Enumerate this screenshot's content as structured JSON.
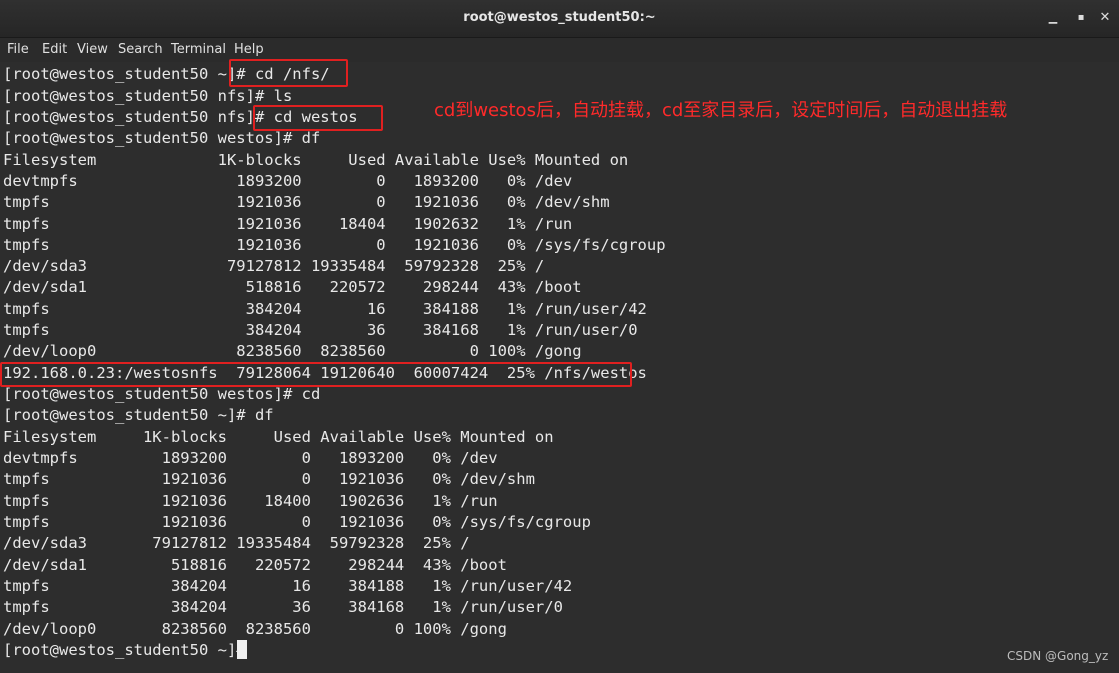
{
  "window": {
    "title": "root@westos_student50:~",
    "minimize_glyph": "▁",
    "maximize_glyph": "▪",
    "close_glyph": "✕"
  },
  "menu": [
    "File",
    "Edit",
    "View",
    "Search",
    "Terminal",
    "Help"
  ],
  "terminal_lines": [
    "[root@westos_student50 ~]# cd /nfs/",
    "[root@westos_student50 nfs]# ls",
    "[root@westos_student50 nfs]# cd westos",
    "[root@westos_student50 westos]# df",
    "Filesystem             1K-blocks     Used Available Use% Mounted on",
    "devtmpfs                 1893200        0   1893200   0% /dev",
    "tmpfs                    1921036        0   1921036   0% /dev/shm",
    "tmpfs                    1921036    18404   1902632   1% /run",
    "tmpfs                    1921036        0   1921036   0% /sys/fs/cgroup",
    "/dev/sda3               79127812 19335484  59792328  25% /",
    "/dev/sda1                 518816   220572    298244  43% /boot",
    "tmpfs                     384204       16    384188   1% /run/user/42",
    "tmpfs                     384204       36    384168   1% /run/user/0",
    "/dev/loop0               8238560  8238560         0 100% /gong",
    "192.168.0.23:/westosnfs  79128064 19120640  60007424  25% /nfs/westos",
    "[root@westos_student50 westos]# cd",
    "[root@westos_student50 ~]# df",
    "Filesystem     1K-blocks     Used Available Use% Mounted on",
    "devtmpfs         1893200        0   1893200   0% /dev",
    "tmpfs            1921036        0   1921036   0% /dev/shm",
    "tmpfs            1921036    18400   1902636   1% /run",
    "tmpfs            1921036        0   1921036   0% /sys/fs/cgroup",
    "/dev/sda3       79127812 19335484  59792328  25% /",
    "/dev/sda1         518816   220572    298244  43% /boot",
    "tmpfs             384204       16    384188   1% /run/user/42",
    "tmpfs             384204       36    384168   1% /run/user/0",
    "/dev/loop0       8238560  8238560         0 100% /gong",
    "[root@westos_student50 ~]# "
  ],
  "annotation": "cd到westos后，自动挂载，cd至家目录后，设定时间后，自动退出挂载",
  "watermark": "CSDN @Gong_yz",
  "colors": {
    "background": "#2d2d2d",
    "text": "#e8e8e8",
    "highlight": "#e02020",
    "annotation": "#ff2a2a"
  }
}
